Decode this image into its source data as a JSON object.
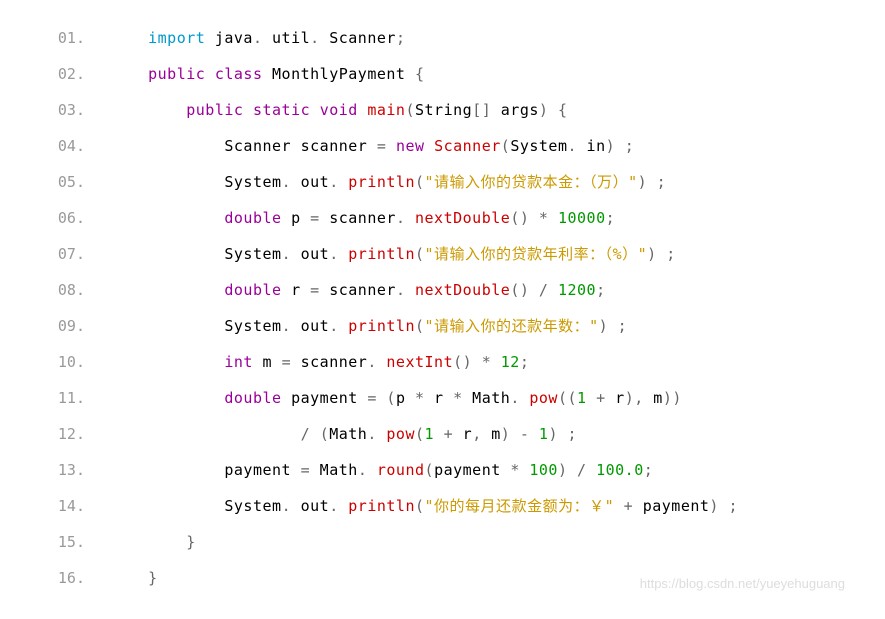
{
  "lines": [
    {
      "no": "01.",
      "tokens": [
        {
          "t": "code",
          "v": "    "
        },
        {
          "t": "kw-import",
          "v": "import"
        },
        {
          "t": "code",
          "v": " java"
        },
        {
          "t": "punct",
          "v": "."
        },
        {
          "t": "code",
          "v": " util"
        },
        {
          "t": "punct",
          "v": "."
        },
        {
          "t": "code",
          "v": " Scanner"
        },
        {
          "t": "punct",
          "v": ";"
        }
      ]
    },
    {
      "no": "02.",
      "tokens": [
        {
          "t": "code",
          "v": "    "
        },
        {
          "t": "kw",
          "v": "public"
        },
        {
          "t": "code",
          "v": " "
        },
        {
          "t": "kw",
          "v": "class"
        },
        {
          "t": "code",
          "v": " MonthlyPayment "
        },
        {
          "t": "punct",
          "v": "{"
        }
      ]
    },
    {
      "no": "03.",
      "tokens": [
        {
          "t": "code",
          "v": "        "
        },
        {
          "t": "kw",
          "v": "public"
        },
        {
          "t": "code",
          "v": " "
        },
        {
          "t": "kw",
          "v": "static"
        },
        {
          "t": "code",
          "v": " "
        },
        {
          "t": "kw",
          "v": "void"
        },
        {
          "t": "code",
          "v": " "
        },
        {
          "t": "method",
          "v": "main"
        },
        {
          "t": "punct",
          "v": "("
        },
        {
          "t": "code",
          "v": "String"
        },
        {
          "t": "punct",
          "v": "[]"
        },
        {
          "t": "code",
          "v": " args"
        },
        {
          "t": "punct",
          "v": ")"
        },
        {
          "t": "code",
          "v": " "
        },
        {
          "t": "punct",
          "v": "{"
        }
      ]
    },
    {
      "no": "04.",
      "tokens": [
        {
          "t": "code",
          "v": "            Scanner scanner "
        },
        {
          "t": "punct",
          "v": "="
        },
        {
          "t": "code",
          "v": " "
        },
        {
          "t": "kw",
          "v": "new"
        },
        {
          "t": "code",
          "v": " "
        },
        {
          "t": "method",
          "v": "Scanner"
        },
        {
          "t": "punct",
          "v": "("
        },
        {
          "t": "code",
          "v": "System"
        },
        {
          "t": "punct",
          "v": "."
        },
        {
          "t": "code",
          "v": " in"
        },
        {
          "t": "punct",
          "v": ")"
        },
        {
          "t": "code",
          "v": " "
        },
        {
          "t": "punct",
          "v": ";"
        }
      ]
    },
    {
      "no": "05.",
      "tokens": [
        {
          "t": "code",
          "v": "            System"
        },
        {
          "t": "punct",
          "v": "."
        },
        {
          "t": "code",
          "v": " out"
        },
        {
          "t": "punct",
          "v": "."
        },
        {
          "t": "code",
          "v": " "
        },
        {
          "t": "method",
          "v": "println"
        },
        {
          "t": "punct",
          "v": "("
        },
        {
          "t": "str",
          "v": "\"请输入你的贷款本金：（万）\""
        },
        {
          "t": "punct",
          "v": ")"
        },
        {
          "t": "code",
          "v": " "
        },
        {
          "t": "punct",
          "v": ";"
        }
      ]
    },
    {
      "no": "06.",
      "tokens": [
        {
          "t": "code",
          "v": "            "
        },
        {
          "t": "kw",
          "v": "double"
        },
        {
          "t": "code",
          "v": " p "
        },
        {
          "t": "punct",
          "v": "="
        },
        {
          "t": "code",
          "v": " scanner"
        },
        {
          "t": "punct",
          "v": "."
        },
        {
          "t": "code",
          "v": " "
        },
        {
          "t": "method",
          "v": "nextDouble"
        },
        {
          "t": "punct",
          "v": "()"
        },
        {
          "t": "code",
          "v": " "
        },
        {
          "t": "punct",
          "v": "*"
        },
        {
          "t": "code",
          "v": " "
        },
        {
          "t": "num",
          "v": "10000"
        },
        {
          "t": "punct",
          "v": ";"
        }
      ]
    },
    {
      "no": "07.",
      "tokens": [
        {
          "t": "code",
          "v": "            System"
        },
        {
          "t": "punct",
          "v": "."
        },
        {
          "t": "code",
          "v": " out"
        },
        {
          "t": "punct",
          "v": "."
        },
        {
          "t": "code",
          "v": " "
        },
        {
          "t": "method",
          "v": "println"
        },
        {
          "t": "punct",
          "v": "("
        },
        {
          "t": "str",
          "v": "\"请输入你的贷款年利率：（%）\""
        },
        {
          "t": "punct",
          "v": ")"
        },
        {
          "t": "code",
          "v": " "
        },
        {
          "t": "punct",
          "v": ";"
        }
      ]
    },
    {
      "no": "08.",
      "tokens": [
        {
          "t": "code",
          "v": "            "
        },
        {
          "t": "kw",
          "v": "double"
        },
        {
          "t": "code",
          "v": " r "
        },
        {
          "t": "punct",
          "v": "="
        },
        {
          "t": "code",
          "v": " scanner"
        },
        {
          "t": "punct",
          "v": "."
        },
        {
          "t": "code",
          "v": " "
        },
        {
          "t": "method",
          "v": "nextDouble"
        },
        {
          "t": "punct",
          "v": "()"
        },
        {
          "t": "code",
          "v": " "
        },
        {
          "t": "punct",
          "v": "/"
        },
        {
          "t": "code",
          "v": " "
        },
        {
          "t": "num",
          "v": "1200"
        },
        {
          "t": "punct",
          "v": ";"
        }
      ]
    },
    {
      "no": "09.",
      "tokens": [
        {
          "t": "code",
          "v": "            System"
        },
        {
          "t": "punct",
          "v": "."
        },
        {
          "t": "code",
          "v": " out"
        },
        {
          "t": "punct",
          "v": "."
        },
        {
          "t": "code",
          "v": " "
        },
        {
          "t": "method",
          "v": "println"
        },
        {
          "t": "punct",
          "v": "("
        },
        {
          "t": "str",
          "v": "\"请输入你的还款年数：\""
        },
        {
          "t": "punct",
          "v": ")"
        },
        {
          "t": "code",
          "v": " "
        },
        {
          "t": "punct",
          "v": ";"
        }
      ]
    },
    {
      "no": "10.",
      "tokens": [
        {
          "t": "code",
          "v": "            "
        },
        {
          "t": "kw",
          "v": "int"
        },
        {
          "t": "code",
          "v": " m "
        },
        {
          "t": "punct",
          "v": "="
        },
        {
          "t": "code",
          "v": " scanner"
        },
        {
          "t": "punct",
          "v": "."
        },
        {
          "t": "code",
          "v": " "
        },
        {
          "t": "method",
          "v": "nextInt"
        },
        {
          "t": "punct",
          "v": "()"
        },
        {
          "t": "code",
          "v": " "
        },
        {
          "t": "punct",
          "v": "*"
        },
        {
          "t": "code",
          "v": " "
        },
        {
          "t": "num",
          "v": "12"
        },
        {
          "t": "punct",
          "v": ";"
        }
      ]
    },
    {
      "no": "11.",
      "tokens": [
        {
          "t": "code",
          "v": "            "
        },
        {
          "t": "kw",
          "v": "double"
        },
        {
          "t": "code",
          "v": " payment "
        },
        {
          "t": "punct",
          "v": "="
        },
        {
          "t": "code",
          "v": " "
        },
        {
          "t": "punct",
          "v": "("
        },
        {
          "t": "code",
          "v": "p "
        },
        {
          "t": "punct",
          "v": "*"
        },
        {
          "t": "code",
          "v": " r "
        },
        {
          "t": "punct",
          "v": "*"
        },
        {
          "t": "code",
          "v": " Math"
        },
        {
          "t": "punct",
          "v": "."
        },
        {
          "t": "code",
          "v": " "
        },
        {
          "t": "method",
          "v": "pow"
        },
        {
          "t": "punct",
          "v": "(("
        },
        {
          "t": "num",
          "v": "1"
        },
        {
          "t": "code",
          "v": " "
        },
        {
          "t": "punct",
          "v": "+"
        },
        {
          "t": "code",
          "v": " r"
        },
        {
          "t": "punct",
          "v": "),"
        },
        {
          "t": "code",
          "v": " m"
        },
        {
          "t": "punct",
          "v": "))"
        }
      ]
    },
    {
      "no": "12.",
      "tokens": [
        {
          "t": "code",
          "v": "                    "
        },
        {
          "t": "punct",
          "v": "/"
        },
        {
          "t": "code",
          "v": " "
        },
        {
          "t": "punct",
          "v": "("
        },
        {
          "t": "code",
          "v": "Math"
        },
        {
          "t": "punct",
          "v": "."
        },
        {
          "t": "code",
          "v": " "
        },
        {
          "t": "method",
          "v": "pow"
        },
        {
          "t": "punct",
          "v": "("
        },
        {
          "t": "num",
          "v": "1"
        },
        {
          "t": "code",
          "v": " "
        },
        {
          "t": "punct",
          "v": "+"
        },
        {
          "t": "code",
          "v": " r"
        },
        {
          "t": "punct",
          "v": ","
        },
        {
          "t": "code",
          "v": " m"
        },
        {
          "t": "punct",
          "v": ")"
        },
        {
          "t": "code",
          "v": " "
        },
        {
          "t": "punct",
          "v": "-"
        },
        {
          "t": "code",
          "v": " "
        },
        {
          "t": "num",
          "v": "1"
        },
        {
          "t": "punct",
          "v": ")"
        },
        {
          "t": "code",
          "v": " "
        },
        {
          "t": "punct",
          "v": ";"
        }
      ]
    },
    {
      "no": "13.",
      "tokens": [
        {
          "t": "code",
          "v": "            payment "
        },
        {
          "t": "punct",
          "v": "="
        },
        {
          "t": "code",
          "v": " Math"
        },
        {
          "t": "punct",
          "v": "."
        },
        {
          "t": "code",
          "v": " "
        },
        {
          "t": "method",
          "v": "round"
        },
        {
          "t": "punct",
          "v": "("
        },
        {
          "t": "code",
          "v": "payment "
        },
        {
          "t": "punct",
          "v": "*"
        },
        {
          "t": "code",
          "v": " "
        },
        {
          "t": "num",
          "v": "100"
        },
        {
          "t": "punct",
          "v": ")"
        },
        {
          "t": "code",
          "v": " "
        },
        {
          "t": "punct",
          "v": "/"
        },
        {
          "t": "code",
          "v": " "
        },
        {
          "t": "num",
          "v": "100.0"
        },
        {
          "t": "punct",
          "v": ";"
        }
      ]
    },
    {
      "no": "14.",
      "tokens": [
        {
          "t": "code",
          "v": "            System"
        },
        {
          "t": "punct",
          "v": "."
        },
        {
          "t": "code",
          "v": " out"
        },
        {
          "t": "punct",
          "v": "."
        },
        {
          "t": "code",
          "v": " "
        },
        {
          "t": "method",
          "v": "println"
        },
        {
          "t": "punct",
          "v": "("
        },
        {
          "t": "str",
          "v": "\"你的每月还款金额为：￥\""
        },
        {
          "t": "code",
          "v": " "
        },
        {
          "t": "punct",
          "v": "+"
        },
        {
          "t": "code",
          "v": " payment"
        },
        {
          "t": "punct",
          "v": ")"
        },
        {
          "t": "code",
          "v": " "
        },
        {
          "t": "punct",
          "v": ";"
        }
      ]
    },
    {
      "no": "15.",
      "tokens": [
        {
          "t": "code",
          "v": "        "
        },
        {
          "t": "punct",
          "v": "}"
        }
      ]
    },
    {
      "no": "16.",
      "tokens": [
        {
          "t": "code",
          "v": "    "
        },
        {
          "t": "punct",
          "v": "}"
        }
      ]
    }
  ],
  "watermark": "https://blog.csdn.net/yueyehuguang"
}
